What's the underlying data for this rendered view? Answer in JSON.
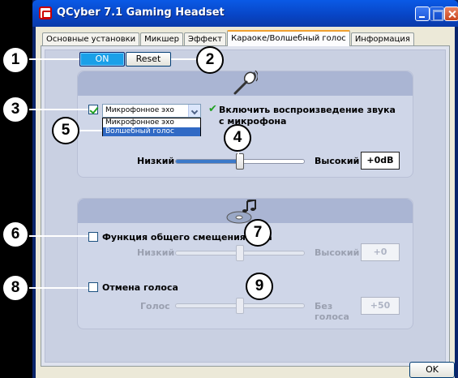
{
  "window": {
    "title": "QCyber 7.1 Gaming Headset"
  },
  "tabs": [
    {
      "label": "Основные установки",
      "active": false
    },
    {
      "label": "Микшер",
      "active": false
    },
    {
      "label": "Эффект",
      "active": false
    },
    {
      "label": "Караоке/Волшебный голос",
      "active": true
    },
    {
      "label": "Информация",
      "active": false
    }
  ],
  "controls": {
    "on_label": "ON",
    "reset_label": "Reset"
  },
  "section1": {
    "checkbox_checked": true,
    "mode_selected": "Микрофонное эхо",
    "mode_options": [
      "Микрофонное эхо",
      "Волшебный голос"
    ],
    "highlighted_option": "Волшебный голос",
    "playback_label_line1": "Включить воспроизведение звука",
    "playback_label_line2": "с микрофона",
    "slider": {
      "low_label": "Низкий",
      "high_label": "Высокий",
      "value": "+0dB",
      "position": 0.5
    }
  },
  "section2": {
    "pitch": {
      "label": "Функция общего смещения тона",
      "checked": false,
      "low_label": "Низкий",
      "high_label": "Высокий",
      "value": "+0",
      "position": 0.5
    },
    "cancel": {
      "label": "Отмена голоса",
      "checked": false,
      "low_label": "Голос",
      "high_label_line1": "Без",
      "high_label_line2": "голоса",
      "value": "+50",
      "position": 0.5
    }
  },
  "ok_label": "OK",
  "callouts": [
    "1",
    "2",
    "3",
    "4",
    "5",
    "6",
    "7",
    "8",
    "9"
  ],
  "icons": {
    "mic": "microphone-icon",
    "cd": "music-disc-icon"
  },
  "colors": {
    "on_button": "#1aa0e8",
    "titlebar": "#0844c4",
    "check": "#21a121",
    "selection": "#316ac5"
  }
}
